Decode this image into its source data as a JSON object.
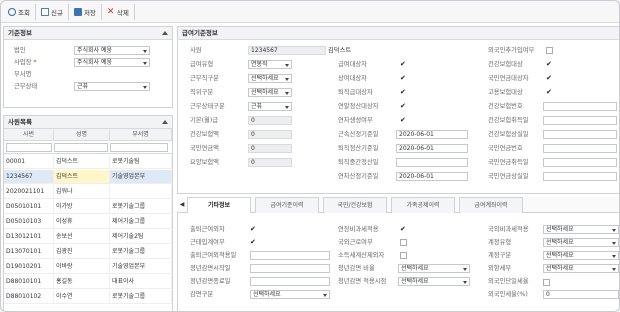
{
  "toolbar": {
    "search": "조회",
    "new": "신규",
    "save": "저장",
    "delete": "삭제"
  },
  "base": {
    "title": "기준정보",
    "corp_label": "법인",
    "corp_value": "주식회사 예웅",
    "site_label": "사업장",
    "site_value": "주식회사 예웅",
    "dept_label": "부서명",
    "status_label": "근무상태",
    "status_value": "근퓨"
  },
  "emp_list": {
    "title": "사원목록",
    "columns": [
      "사번",
      "성명",
      "부서명"
    ],
    "rows": [
      [
        "00001",
        "김덕스트",
        "로봇기술팀"
      ],
      [
        "1234567",
        "김덕스트",
        "기술영업본부"
      ],
      [
        "2020021101",
        "김워나",
        ""
      ],
      [
        "D05010101",
        "이가방",
        "로봇기술그룹"
      ],
      [
        "D05010103",
        "이성휴",
        "제어기술그룹"
      ],
      [
        "D13012101",
        "송보선",
        "제어기술2팀"
      ],
      [
        "D13070101",
        "김광진",
        "로봇기술그룹"
      ],
      [
        "D19010201",
        "이바랑",
        "기술영업본부"
      ],
      [
        "D88010101",
        "홍길동",
        "대표이사"
      ],
      [
        "D88010102",
        "이수연",
        "로봇기술그룹"
      ]
    ]
  },
  "pay": {
    "title": "급여기준정보",
    "emp_no_label": "사원",
    "emp_no": "1234567",
    "emp_name": "김덕스트",
    "pay_type_label": "급여유형",
    "pay_type": "연봉직",
    "work_type_label": "근무직구분",
    "work_type": "선택하세요",
    "job_type_label": "직위구분",
    "job_type": "선택하세요",
    "work_class_label": "근무상태구분",
    "work_class": "근퓨",
    "base_amount_label": "기본(월)급",
    "base_amount": "0",
    "health_amount_label": "건강보험액",
    "health_amount": "0",
    "pension_amount_label": "국민연금액",
    "pension_amount": "0",
    "emp_ins_amount_label": "요양보험액",
    "emp_ins_amount": "0",
    "checks": [
      {
        "label": "급여대상자",
        "checked": true
      },
      {
        "label": "상여대상자",
        "checked": true
      },
      {
        "label": "퇴직급대상자",
        "checked": true
      },
      {
        "label": "연말정산대상자",
        "checked": true
      },
      {
        "label": "연차생성여부",
        "checked": true
      }
    ],
    "dates": [
      {
        "label": "근속산정기준일",
        "value": "2020-06-01"
      },
      {
        "label": "퇴직정산기준일",
        "value": "2020-06-01"
      },
      {
        "label": "퇴직중간정산일",
        "value": ""
      },
      {
        "label": "연차산정기준일",
        "value": "2020-06-01"
      }
    ],
    "right_checks": [
      {
        "label": "외국인추가입여부",
        "checked": false
      },
      {
        "label": "건강보험대상",
        "checked": true
      },
      {
        "label": "국민연금대상자",
        "checked": true
      },
      {
        "label": "고용보험대상",
        "checked": true
      }
    ],
    "right_fields": [
      "건강보험번호",
      "건강보험취득일",
      "건강보험상실일",
      "국민연금번호",
      "국민연금취득일",
      "국민연금상실일"
    ]
  },
  "tabs": [
    "기타정보",
    "급여기준이력",
    "국민/건강보험",
    "가족공제이력",
    "급여계좌이력"
  ],
  "other": {
    "col1": [
      {
        "label": "출퇴근여외자",
        "checked": true
      },
      {
        "label": "근태입계여부",
        "checked": true
      },
      {
        "label": "출퇴근여외적용일",
        "checked": false
      },
      {
        "label": "정년감면시작일",
        "checked": false
      },
      {
        "label": "정년감면종료일",
        "checked": false
      }
    ],
    "reduction_label": "감면구분",
    "reduction_value": "선택하세요",
    "col2": [
      {
        "label": "연장비과세적용",
        "checked": true
      },
      {
        "label": "국외근로여부",
        "checked": false
      },
      {
        "label": "소득세계산제외자",
        "checked": false
      }
    ],
    "youth_rate_label": "청년감면 비율",
    "youth_rate_value": "선택하세요",
    "youth_apply_label": "청년감면 적용시점",
    "youth_apply_value": "선택하세요",
    "col3": [
      {
        "label": "국외비과세적용",
        "value": "선택하세요"
      },
      {
        "label": "계정유형",
        "value": "선택하세요"
      },
      {
        "label": "계정구분",
        "value": "선택하세요"
      },
      {
        "label": "외항세부",
        "value": "선택하세요"
      }
    ],
    "foreign_label": "외국인단일세율",
    "foreign_rate_label": "외국인세율(%)",
    "foreign_rate_value": "0"
  }
}
